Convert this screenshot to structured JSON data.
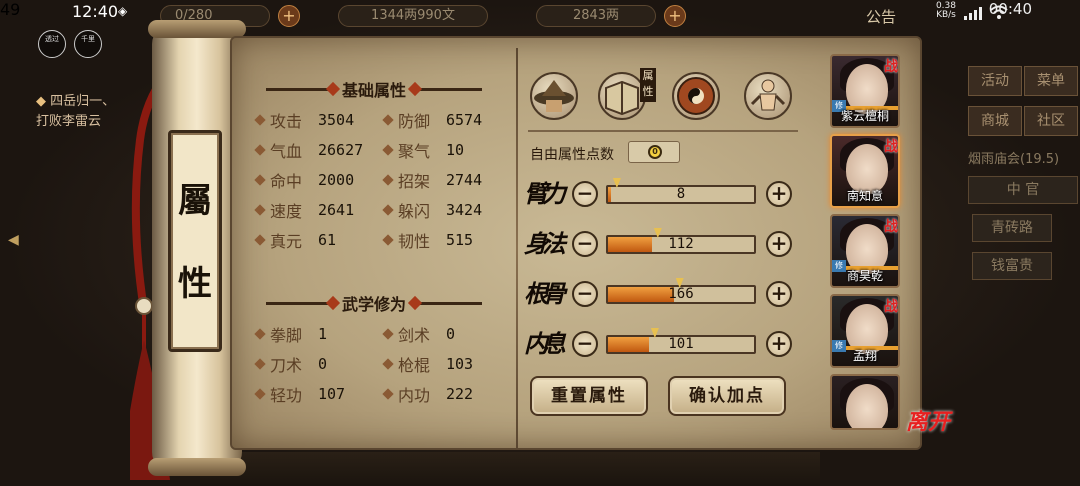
{
  "status_bar": {
    "time_left": "12:40",
    "time_right": "00:40",
    "net_speed": "0.38",
    "net_unit": "KB/s",
    "battery": "49"
  },
  "float_buttons": [
    {
      "label": "透过"
    },
    {
      "label": "千里"
    }
  ],
  "resources": {
    "slot1": "0/280",
    "coins": "1344两990文",
    "silver": "2843两"
  },
  "announcement": "公告",
  "quest": {
    "title": "四岳归一、",
    "desc": "打败李雷云"
  },
  "side_menu": {
    "activity": "活动",
    "menu": "菜单",
    "shop": "商城",
    "community": "社区",
    "event": "烟雨庙会",
    "event_timer": "(19.5)",
    "middle": "中 官",
    "road": "青砖路",
    "rich": "钱富贵"
  },
  "scroll_title": {
    "char1": "屬",
    "char2": "性"
  },
  "basic_title": "基础属性",
  "basic_stats": [
    {
      "label": "攻击",
      "value": "3504"
    },
    {
      "label": "防御",
      "value": "6574"
    },
    {
      "label": "气血",
      "value": "26627"
    },
    {
      "label": "聚气",
      "value": "10"
    },
    {
      "label": "命中",
      "value": "2000"
    },
    {
      "label": "招架",
      "value": "2744"
    },
    {
      "label": "速度",
      "value": "2641"
    },
    {
      "label": "躲闪",
      "value": "3424"
    },
    {
      "label": "真元",
      "value": "61"
    },
    {
      "label": "韧性",
      "value": "515"
    }
  ],
  "martial_title": "武学修为",
  "martial_stats": [
    {
      "label": "拳脚",
      "value": "1"
    },
    {
      "label": "剑术",
      "value": "0"
    },
    {
      "label": "刀术",
      "value": "0"
    },
    {
      "label": "枪棍",
      "value": "103"
    },
    {
      "label": "轻功",
      "value": "107"
    },
    {
      "label": "内功",
      "value": "222"
    }
  ],
  "tabs": [
    {
      "icon": "hat-icon"
    },
    {
      "icon": "book-icon",
      "label": "属性"
    },
    {
      "icon": "bagua-icon"
    },
    {
      "icon": "meridian-figure-icon"
    }
  ],
  "free_points_label": "自由属性点数",
  "free_points_value": "0",
  "attributes": [
    {
      "name": "臂力",
      "value": "8",
      "fill": 0.02
    },
    {
      "name": "身法",
      "value": "112",
      "fill": 0.3
    },
    {
      "name": "根骨",
      "value": "166",
      "fill": 0.45
    },
    {
      "name": "内息",
      "value": "101",
      "fill": 0.28
    }
  ],
  "buttons": {
    "reset": "重置属性",
    "confirm": "确认加点"
  },
  "characters": [
    {
      "name": "紫云檀桐",
      "battle": "战",
      "xiu": "修"
    },
    {
      "name": "南知意",
      "battle": "战",
      "xiu": ""
    },
    {
      "name": "商昊乾",
      "battle": "战",
      "xiu": "修"
    },
    {
      "name": "孟翔",
      "battle": "战",
      "xiu": "修"
    },
    {
      "name": "",
      "battle": "",
      "xiu": ""
    }
  ],
  "leave": "离开",
  "colors": {
    "accent": "#e8a048",
    "fill": "#c05810",
    "battle": "#e02020"
  }
}
